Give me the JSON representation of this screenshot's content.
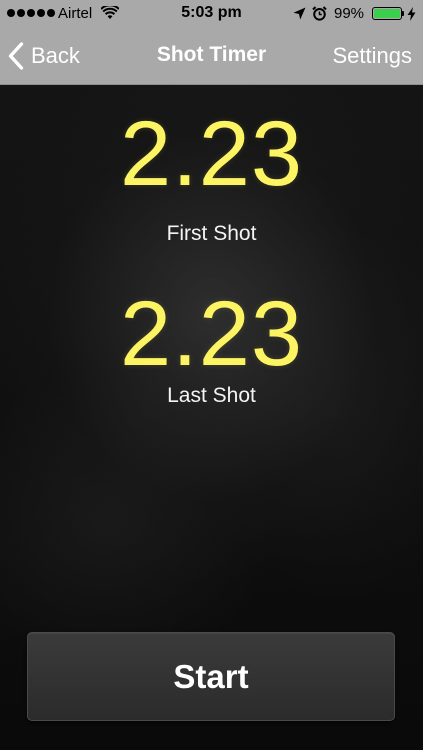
{
  "status_bar": {
    "carrier": "Airtel",
    "time": "5:03 pm",
    "battery_percent": "99%",
    "battery_level": 0.99,
    "signal_bars": 5,
    "icons": [
      "wifi-icon",
      "location-arrow-icon",
      "alarm-clock-icon",
      "battery-icon",
      "charging-bolt-icon"
    ]
  },
  "nav": {
    "back_label": "Back",
    "title": "Shot Timer",
    "settings_label": "Settings",
    "icons": [
      "chevron-left-icon"
    ]
  },
  "timer": {
    "first_shot_value": "2.23",
    "first_shot_label": "First Shot",
    "last_shot_value": "2.23",
    "last_shot_label": "Last Shot"
  },
  "actions": {
    "start_label": "Start"
  },
  "colors": {
    "bar_background": "#a9a9a9",
    "time_text": "#fdf463",
    "battery_fill": "#3ccf4e",
    "screen_background": "#111111"
  }
}
